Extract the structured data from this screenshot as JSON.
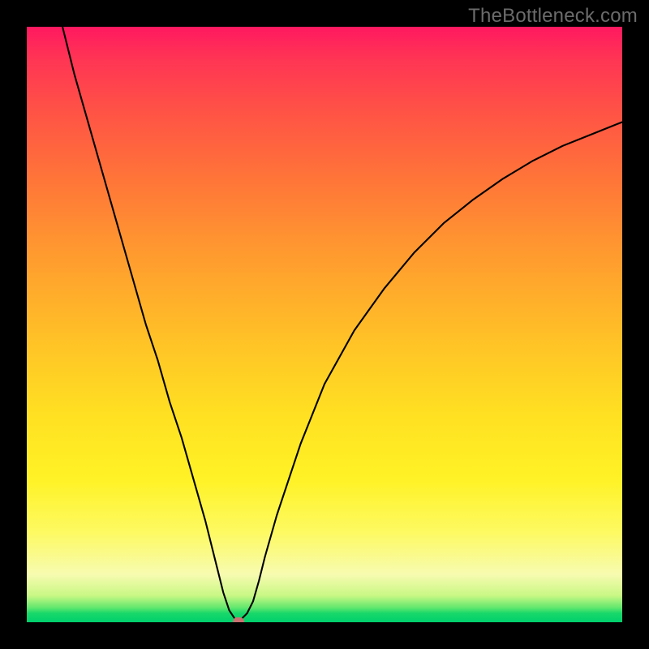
{
  "watermark": "TheBottleneck.com",
  "chart_data": {
    "type": "line",
    "title": "",
    "xlabel": "",
    "ylabel": "",
    "xlim": [
      0,
      100
    ],
    "ylim": [
      0,
      100
    ],
    "background_gradient": {
      "direction": "top-to-bottom",
      "stops": [
        {
          "pos": 0,
          "color": "#ff1860"
        },
        {
          "pos": 14,
          "color": "#ff5246"
        },
        {
          "pos": 38,
          "color": "#ff9a2f"
        },
        {
          "pos": 65,
          "color": "#ffe022"
        },
        {
          "pos": 85,
          "color": "#fdfa63"
        },
        {
          "pos": 95,
          "color": "#c9f885"
        },
        {
          "pos": 100,
          "color": "#00cf6c"
        }
      ]
    },
    "series": [
      {
        "name": "bottleneck-curve",
        "x": [
          6,
          8,
          10,
          12,
          14,
          16,
          18,
          20,
          22,
          24,
          26,
          28,
          30,
          32,
          33,
          34,
          35,
          36,
          37,
          38,
          39,
          40,
          42,
          44,
          46,
          48,
          50,
          55,
          60,
          65,
          70,
          75,
          80,
          85,
          90,
          95,
          100
        ],
        "y": [
          100,
          92,
          85,
          78,
          71,
          64,
          57,
          50,
          44,
          37,
          31,
          24,
          17,
          9,
          5,
          2,
          0.5,
          0.5,
          1.5,
          3.5,
          7,
          11,
          18,
          24,
          30,
          35,
          40,
          49,
          56,
          62,
          67,
          71,
          74.5,
          77.5,
          80,
          82,
          84
        ]
      }
    ],
    "marker": {
      "x": 35.5,
      "y": 0.2,
      "color": "#cb7171"
    }
  }
}
